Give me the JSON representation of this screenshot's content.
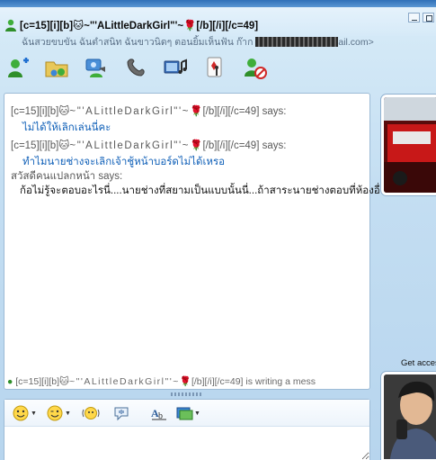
{
  "window": {
    "title": "[c=15][i][b]☹~\"'ALittleDarkGirl\"'~⚘[/b][/i][/c=49]",
    "title_prefix": "[c=15][i][b]",
    "title_name": "~\"'ALittleDarkGirl\"'~",
    "title_suffix": "[/b][/i][/c=49]",
    "subtitle_before": "ฉันสวยขบขัน ฉันตำสนิท ฉันขาวนิดๆ ตอนยิ้มเห็นฟัน ก๊าก ",
    "subtitle_after": "ail.com>"
  },
  "toolbar": {
    "buttons": [
      {
        "name": "add-contact-icon"
      },
      {
        "name": "share-folder-icon"
      },
      {
        "name": "video-call-icon"
      },
      {
        "name": "voice-call-icon"
      },
      {
        "name": "media-icon"
      },
      {
        "name": "games-icon"
      },
      {
        "name": "block-icon"
      }
    ]
  },
  "chat": {
    "messages": [
      {
        "sender_prefix": "[c=15][i][b]",
        "sender_name": "~\"'ALittleDarkGirl\"'~",
        "sender_suffix": "[/b][/i][/c=49] says:",
        "text": "ไม่ได้ให้เลิกเล่นนี่คะ",
        "color": "#1060b8"
      },
      {
        "sender_prefix": "[c=15][i][b]",
        "sender_name": "~\"'ALittleDarkGirl\"'~",
        "sender_suffix": "[/b][/i][/c=49] says:",
        "text": "ทำไมนายช่างจะเลิกเจ้าชู้หน้าบอร์ดไม่ได้เหรอ",
        "color": "#1060b8"
      },
      {
        "sender_plain": "สวัสดีคนแปลกหน้า says:",
        "text": "ก้อไม่รู้จะตอบอะไรนี่....นายช่างที่สยามเป็นแบบนั้นนี่...ถ้าสาระนายช่างตอบที่ห้องอื่น",
        "color": "#111111"
      }
    ],
    "typing_prefix": "[c=15][i][b]",
    "typing_name": "~\"'ALittleDarkGirl\"'~",
    "typing_suffix": "[/b][/i][/c=49] is writing a mess"
  },
  "input_toolbar": {
    "buttons": [
      {
        "name": "emoticon-icon"
      },
      {
        "name": "wink-icon"
      },
      {
        "name": "nudge-icon"
      },
      {
        "name": "voice-clip-icon"
      },
      {
        "name": "font-icon"
      },
      {
        "name": "background-icon"
      }
    ]
  },
  "sidebar": {
    "ad_text": "Get acces"
  },
  "colors": {
    "message_blue": "#1060b8",
    "window_bg": "#c4def2",
    "title_bar": "#2f6fb8"
  }
}
